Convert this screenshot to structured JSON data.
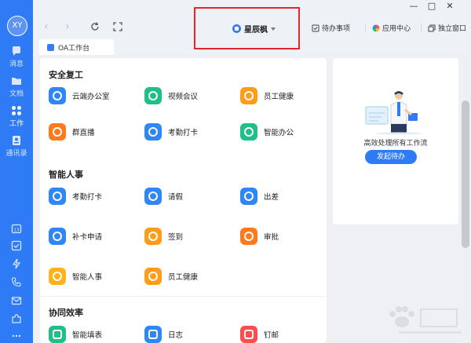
{
  "rail": {
    "avatar_text": "XY",
    "items": [
      {
        "label": "消息"
      },
      {
        "label": "文档"
      },
      {
        "label": "工作"
      },
      {
        "label": "通讯录"
      }
    ],
    "accent": "#2f7bf6"
  },
  "topbar": {
    "tenant_name": "星辰枫",
    "links": {
      "todo": "待办事项",
      "app_center": "应用中心",
      "standalone": "独立窗口"
    },
    "window_controls": {
      "minimize": "—",
      "maximize": "□",
      "close": "✕"
    }
  },
  "tab": {
    "label": "OA工作台"
  },
  "sections": [
    {
      "title": "安全复工",
      "apps": [
        {
          "label": "云端办公室",
          "color": "#2f86f6",
          "icon": "cloud-icon"
        },
        {
          "label": "视频会议",
          "color": "#1fbf8a",
          "icon": "phone-icon"
        },
        {
          "label": "员工健康",
          "color": "#ff9d1b",
          "icon": "heart-icon"
        },
        {
          "label": "群直播",
          "color": "#ff7a1a",
          "icon": "tv-icon"
        },
        {
          "label": "考勤打卡",
          "color": "#2f86f6",
          "icon": "location-icon"
        },
        {
          "label": "智能办公",
          "color": "#1fbf8a",
          "icon": "cap-icon"
        }
      ]
    },
    {
      "title": "智能人事",
      "apps": [
        {
          "label": "考勤打卡",
          "color": "#2f86f6",
          "icon": "location-icon"
        },
        {
          "label": "请假",
          "color": "#2f86f6",
          "icon": "clock-icon"
        },
        {
          "label": "出差",
          "color": "#2f86f6",
          "icon": "suitcase-icon"
        },
        {
          "label": "补卡申请",
          "color": "#2f86f6",
          "icon": "clock-icon"
        },
        {
          "label": "签到",
          "color": "#ff9d1b",
          "icon": "pin-icon"
        },
        {
          "label": "审批",
          "color": "#ff7a1a",
          "icon": "stamp-icon"
        },
        {
          "label": "智能人事",
          "color": "#ffb21a",
          "icon": "n-icon"
        },
        {
          "label": "员工健康",
          "color": "#ff9d1b",
          "icon": "heart-icon"
        }
      ]
    },
    {
      "title": "协同效率",
      "apps": [
        {
          "label": "智能填表",
          "color": "#1fbf8a",
          "icon": "form-icon"
        },
        {
          "label": "日志",
          "color": "#2f86f6",
          "icon": "journal-icon"
        },
        {
          "label": "钉邮",
          "color": "#ff4d4d",
          "icon": "mail-icon"
        }
      ]
    }
  ],
  "panel": {
    "text": "高效处理所有工作流",
    "button": "发起待办"
  }
}
